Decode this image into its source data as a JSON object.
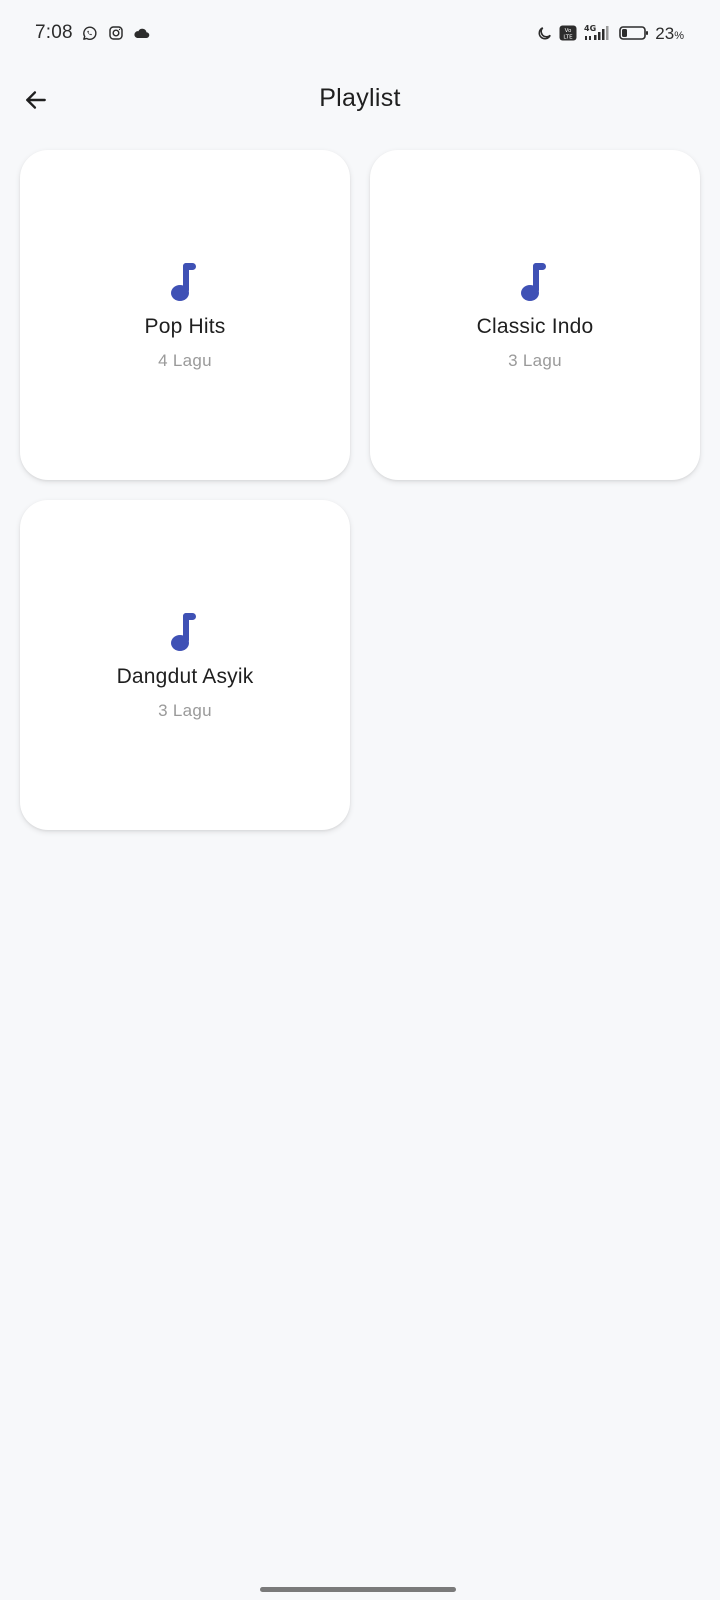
{
  "status_bar": {
    "time": "7:08",
    "icons_left": [
      "whatsapp-icon",
      "instagram-icon",
      "cloud-icon"
    ],
    "icons_right": [
      "moon-icon",
      "volte-icon",
      "signal-4g-icon",
      "battery-icon"
    ],
    "network": "4G",
    "battery_value": "23",
    "battery_unit": "%"
  },
  "header": {
    "title": "Playlist",
    "back_icon": "arrow-left-icon"
  },
  "playlists": [
    {
      "name": "Pop Hits",
      "count": "4 Lagu",
      "icon": "music-note-icon"
    },
    {
      "name": "Classic Indo",
      "count": "3 Lagu",
      "icon": "music-note-icon"
    },
    {
      "name": "Dangdut Asyik",
      "count": "3 Lagu",
      "icon": "music-note-icon"
    }
  ],
  "colors": {
    "accent": "#3f51b5",
    "background": "#f7f8fa",
    "card": "#ffffff",
    "subtext": "#9a9a9a"
  }
}
